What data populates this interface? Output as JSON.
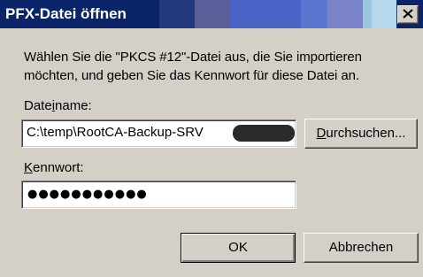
{
  "window": {
    "title": "PFX-Datei öffnen",
    "close_glyph": "close-icon"
  },
  "description": "Wählen Sie die \"PKCS #12\"-Datei aus, die Sie importieren möchten, und geben Sie das Kennwort für diese Datei an.",
  "filename": {
    "label_before": "Date",
    "label_mnemonic": "i",
    "label_after": "name:",
    "value": "C:\\temp\\RootCA-Backup-SRV"
  },
  "browse_button": {
    "mnemonic": "D",
    "label_rest": "urchsuchen..."
  },
  "password": {
    "label_mnemonic": "K",
    "label_rest": "ennwort:",
    "value": "●●●●●●●●●●●"
  },
  "buttons": {
    "ok": "OK",
    "cancel": "Abbrechen"
  },
  "colors": {
    "titlebar": "#0a246a",
    "face": "#d4d0c8"
  }
}
